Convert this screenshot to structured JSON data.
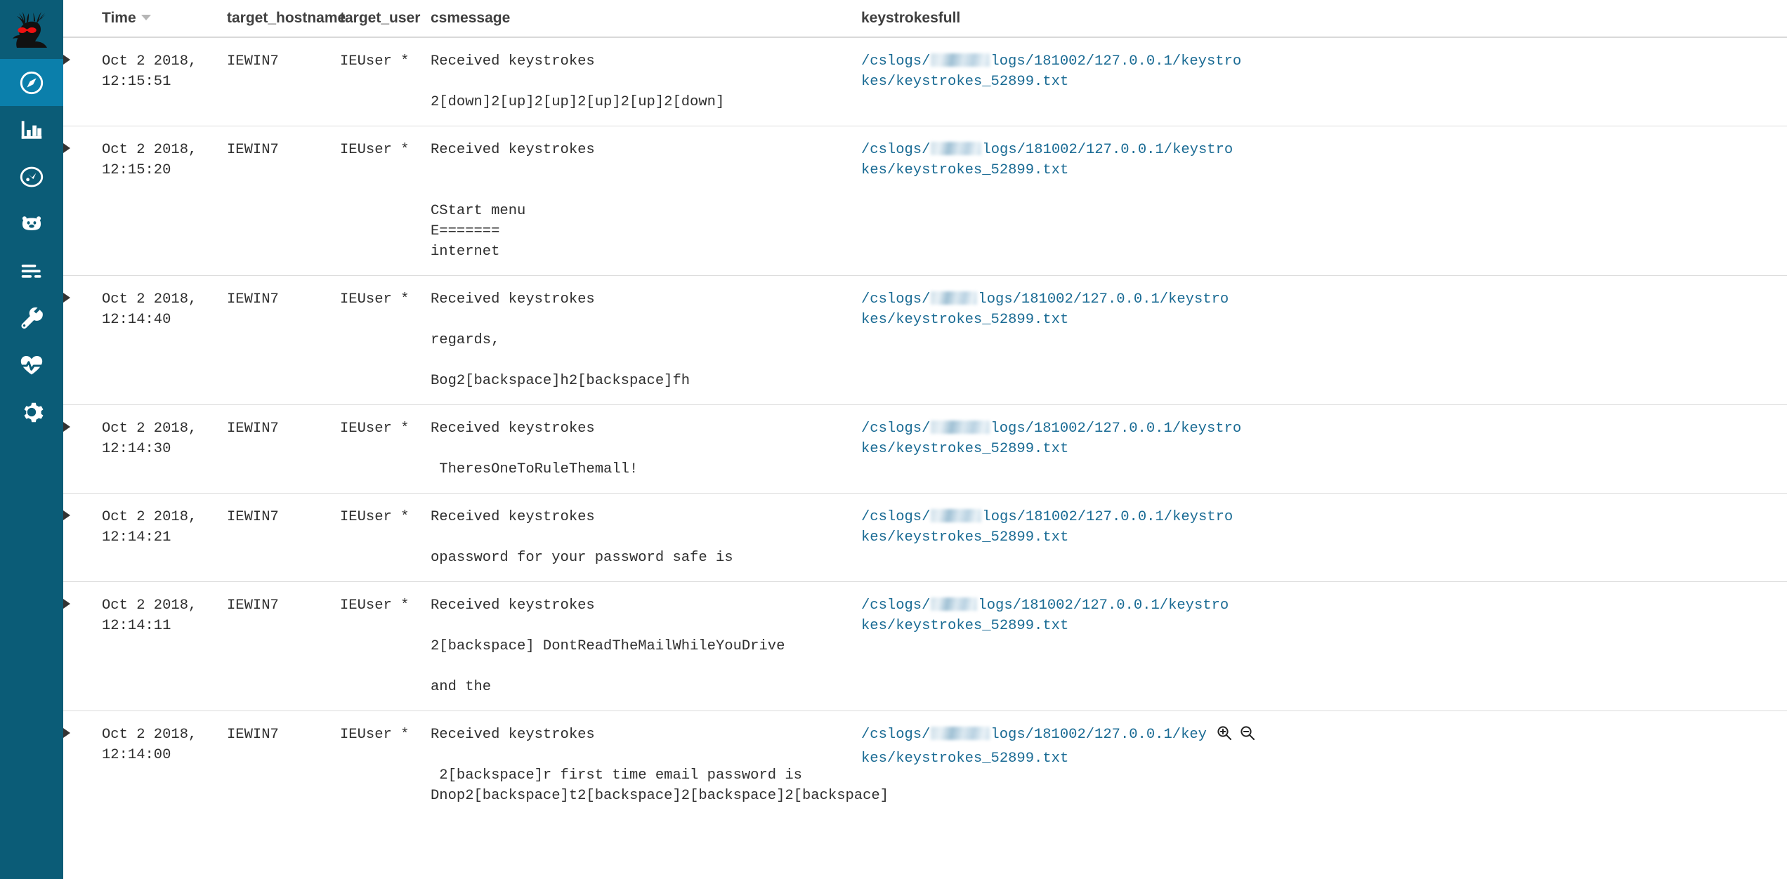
{
  "sidebar": {
    "logo": {
      "name": "elk-head-logo",
      "alt": "Elk head with red sunglasses"
    },
    "items": [
      {
        "icon": "compass-icon",
        "label": "Discover",
        "active": true
      },
      {
        "icon": "bar-chart-icon",
        "label": "Visualize",
        "active": false
      },
      {
        "icon": "dashboard-icon",
        "label": "Dashboard",
        "active": false
      },
      {
        "icon": "bear-face-icon",
        "label": "Timelion",
        "active": false
      },
      {
        "icon": "timeline-icon",
        "label": "Timeline",
        "active": false
      },
      {
        "icon": "wrench-icon",
        "label": "Dev Tools",
        "active": false
      },
      {
        "icon": "heartbeat-icon",
        "label": "Monitoring",
        "active": false
      },
      {
        "icon": "gear-icon",
        "label": "Management",
        "active": false
      }
    ],
    "colors": {
      "background": "#0b5c77",
      "active": "#0b7fab",
      "icon": "#ffffff",
      "logo_accent": "#ee1111"
    }
  },
  "table": {
    "columns": [
      {
        "key": "time",
        "label": "Time",
        "sorted": "desc"
      },
      {
        "key": "target_hostname",
        "label": "target_hostname",
        "sorted": ""
      },
      {
        "key": "target_user",
        "label": "target_user",
        "sorted": ""
      },
      {
        "key": "csmessage",
        "label": "csmessage",
        "sorted": ""
      },
      {
        "key": "keystrokesfull",
        "label": "keystrokesfull",
        "sorted": ""
      }
    ],
    "link_color": "#1a6b94",
    "file_prefix": "/cslogs/",
    "file_suffix_line1": "logs/181002/127.0.0.1/keystro",
    "file_suffix_line1_short": "logs/181002/127.0.0.1/key",
    "file_suffix_line2": "kes/keystrokes_52899.txt",
    "rows": [
      {
        "time": "Oct 2 2018, 12:15:51",
        "target_hostname": "IEWIN7",
        "target_user": "IEUser *",
        "csmessage": [
          "Received keystrokes",
          "",
          "2[down]2[up]2[up]2[up]2[up]2[down]"
        ],
        "file_truncated": false,
        "show_filter_icons": false
      },
      {
        "time": "Oct 2 2018, 12:15:20",
        "target_hostname": "IEWIN7",
        "target_user": "IEUser *",
        "csmessage": [
          "Received keystrokes",
          "",
          "",
          "CStart menu",
          "E=======",
          "internet"
        ],
        "file_truncated": false,
        "show_filter_icons": false
      },
      {
        "time": "Oct 2 2018, 12:14:40",
        "target_hostname": "IEWIN7",
        "target_user": "IEUser *",
        "csmessage": [
          "Received keystrokes",
          "",
          "regards,",
          "",
          "Bog2[backspace]h2[backspace]fh"
        ],
        "file_truncated": false,
        "show_filter_icons": false
      },
      {
        "time": "Oct 2 2018, 12:14:30",
        "target_hostname": "IEWIN7",
        "target_user": "IEUser *",
        "csmessage": [
          "Received keystrokes",
          "",
          " TheresOneToRuleThemall!"
        ],
        "file_truncated": false,
        "show_filter_icons": false
      },
      {
        "time": "Oct 2 2018, 12:14:21",
        "target_hostname": "IEWIN7",
        "target_user": "IEUser *",
        "csmessage": [
          "Received keystrokes",
          "",
          "opassword for your password safe is"
        ],
        "file_truncated": false,
        "show_filter_icons": false
      },
      {
        "time": "Oct 2 2018, 12:14:11",
        "target_hostname": "IEWIN7",
        "target_user": "IEUser *",
        "csmessage": [
          "Received keystrokes",
          "",
          "2[backspace] DontReadTheMailWhileYouDrive",
          "",
          "and the"
        ],
        "file_truncated": false,
        "show_filter_icons": false
      },
      {
        "time": "Oct 2 2018, 12:14:00",
        "target_hostname": "IEWIN7",
        "target_user": "IEUser *",
        "csmessage": [
          "Received keystrokes",
          "",
          " 2[backspace]r first time email password is",
          "Dnop2[backspace]t2[backspace]2[backspace]2[backspace]"
        ],
        "file_truncated": true,
        "show_filter_icons": true,
        "filter_icons": [
          {
            "name": "zoom-in-filter-icon",
            "label": "Filter for value"
          },
          {
            "name": "zoom-out-filter-icon",
            "label": "Filter out value"
          }
        ]
      }
    ]
  }
}
